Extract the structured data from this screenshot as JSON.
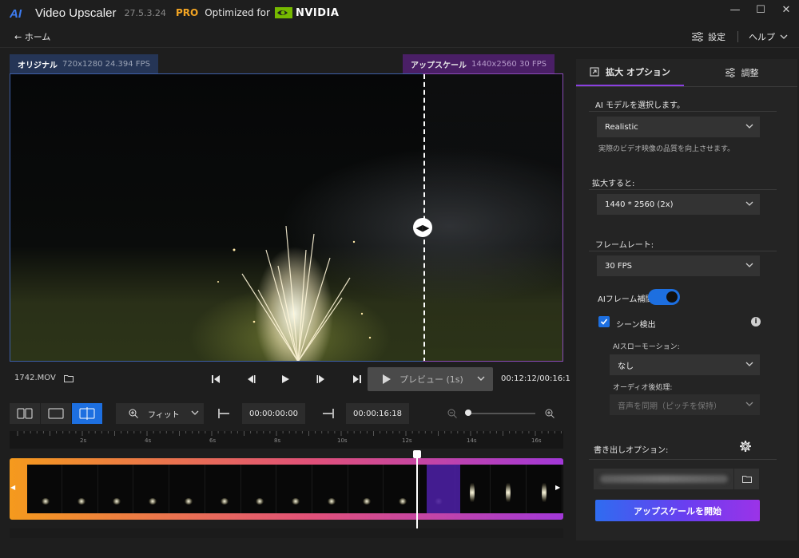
{
  "titlebar": {
    "app_name": "Video Upscaler",
    "version": "27.5.3.24",
    "pro": "PRO",
    "optimized_for": "Optimized for",
    "vendor": "NVIDIA",
    "controls": [
      "—",
      "☐",
      "✕"
    ]
  },
  "nav": {
    "home": "← ホーム",
    "settings": "設定",
    "help": "ヘルプ"
  },
  "preview": {
    "original_label": "オリジナル",
    "original_info": "720x1280 24.394 FPS",
    "upscale_label": "アップスケール",
    "upscale_info": "1440x2560 30 FPS"
  },
  "player": {
    "filename": "1742.MOV",
    "preview_button": "プレビュー (1s)",
    "timecode": "00:12:12/00:16:1"
  },
  "tools": {
    "zoom_label": "フィット",
    "in_time": "00:00:00:00",
    "out_time": "00:00:16:18"
  },
  "ruler": {
    "ticks": [
      "2s",
      "4s",
      "6s",
      "8s",
      "10s",
      "12s",
      "14s",
      "16s"
    ]
  },
  "panel": {
    "tab_enlarge": "拡大 オプション",
    "tab_adjust": "調整",
    "ai_model_label": "AI モデルを選択します。",
    "ai_model_value": "Realistic",
    "ai_model_hint": "実際のビデオ映像の品質を向上させます。",
    "scale_label": "拡大すると:",
    "scale_value": "1440 * 2560 (2x)",
    "framerate_label": "フレームレート:",
    "framerate_value": "30 FPS",
    "ai_interp_label": "AIフレーム補間",
    "ai_interp_on": true,
    "scene_detect_label": "シーン検出",
    "scene_detect_checked": true,
    "slowmo_label": "AIスローモーション:",
    "slowmo_value": "なし",
    "audio_label": "オーディオ後処理:",
    "audio_value": "音声を同期（ピッチを保持）",
    "export_label": "書き出しオプション:",
    "start_button": "アップスケールを開始"
  },
  "colors": {
    "accent_blue": "#1d6fe0",
    "accent_purple": "#8a3fe0",
    "pro_orange": "#f5a623",
    "nvidia_green": "#76b900"
  }
}
